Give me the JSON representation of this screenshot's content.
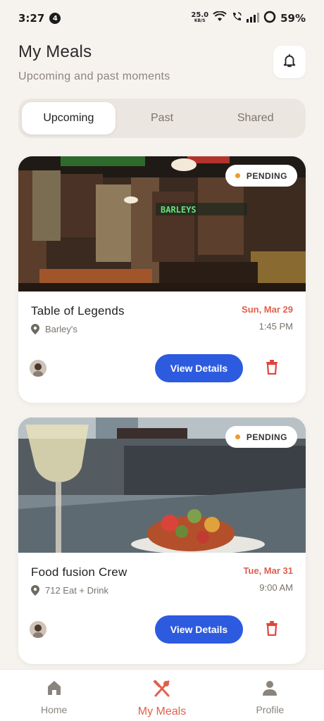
{
  "status_bar": {
    "time": "3:27",
    "notification_count": "4",
    "net_speed_value": "25.0",
    "net_speed_unit": "KB/S",
    "battery": "59%"
  },
  "header": {
    "title": "My Meals",
    "subtitle": "Upcoming and past moments"
  },
  "tabs": [
    {
      "label": "Upcoming",
      "active": true
    },
    {
      "label": "Past",
      "active": false
    },
    {
      "label": "Shared",
      "active": false
    }
  ],
  "meals": [
    {
      "status": "PENDING",
      "title": "Table of Legends",
      "location": "Barley's",
      "date": "Sun, Mar 29",
      "time": "1:45 PM",
      "view_label": "View Details",
      "image_sign": "BARLEYS"
    },
    {
      "status": "PENDING",
      "title": "Food fusion Crew",
      "location": "712 Eat + Drink",
      "date": "Tue, Mar 31",
      "time": "9:00 AM",
      "view_label": "View Details"
    }
  ],
  "nav": [
    {
      "label": "Home",
      "icon": "home-icon",
      "active": false
    },
    {
      "label": "My Meals",
      "icon": "fork-knife-icon",
      "active": true
    },
    {
      "label": "Profile",
      "icon": "person-icon",
      "active": false
    }
  ],
  "colors": {
    "accent": "#e0604c",
    "primary_button": "#2d5bdf",
    "pending_dot": "#f09a2b",
    "background": "#f6f3ef"
  }
}
